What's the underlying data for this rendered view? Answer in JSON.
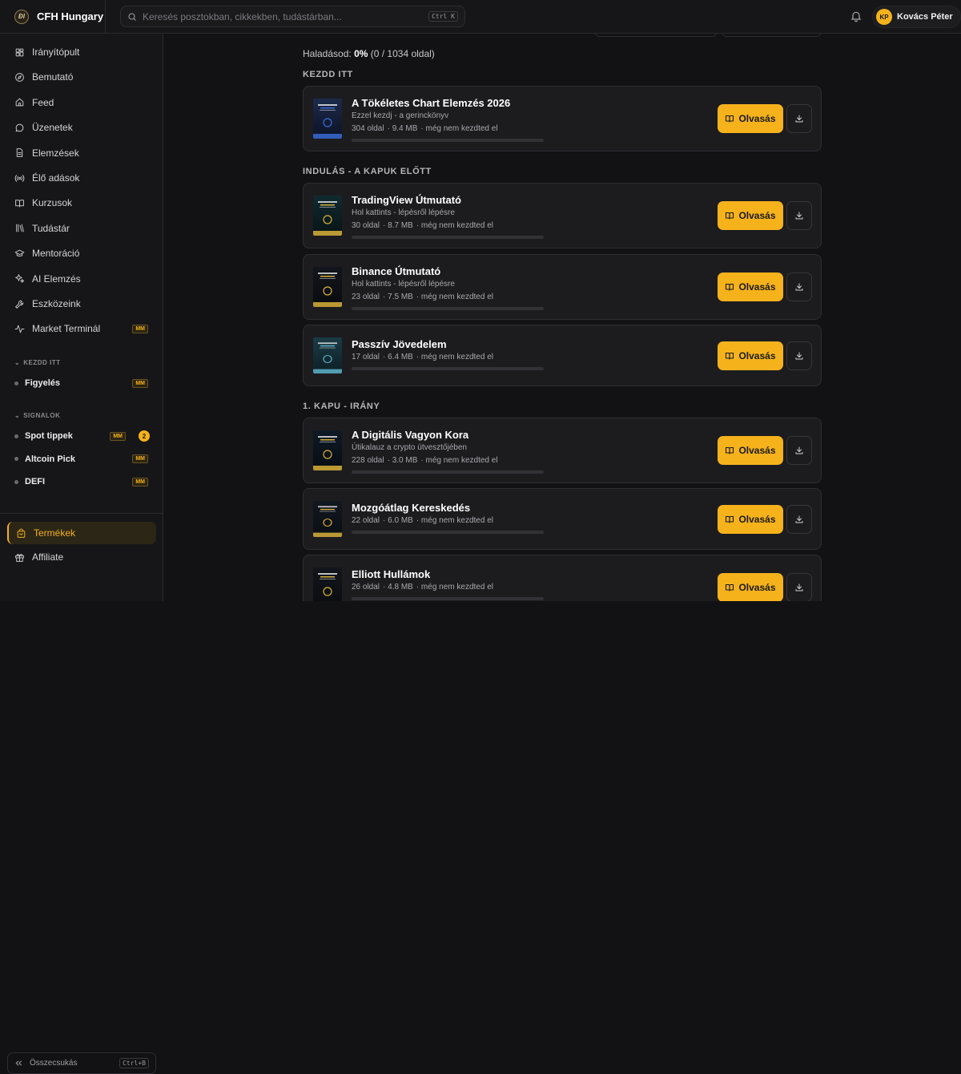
{
  "brand": {
    "logo_text": "ĐI",
    "name": "CFH Hungary"
  },
  "search": {
    "placeholder": "Keresés posztokban, cikkekben, tudástárban...",
    "shortcut": "Ctrl K"
  },
  "user": {
    "initials": "KP",
    "name": "Kovács Péter"
  },
  "sidebar": {
    "items": [
      {
        "label": "Irányítópult",
        "icon": "dashboard-icon"
      },
      {
        "label": "Bemutató",
        "icon": "compass-icon"
      },
      {
        "label": "Feed",
        "icon": "home-icon"
      },
      {
        "label": "Üzenetek",
        "icon": "message-icon"
      },
      {
        "label": "Elemzések",
        "icon": "document-icon"
      },
      {
        "label": "Élő adások",
        "icon": "broadcast-icon"
      },
      {
        "label": "Kurzusok",
        "icon": "book-icon"
      },
      {
        "label": "Tudástár",
        "icon": "library-icon"
      },
      {
        "label": "Mentoráció",
        "icon": "graduation-cap-icon"
      },
      {
        "label": "AI Elemzés",
        "icon": "sparkles-icon"
      },
      {
        "label": "Eszközeink",
        "icon": "wrench-icon"
      },
      {
        "label": "Market Terminál",
        "icon": "activity-icon",
        "badge": "MM"
      }
    ],
    "sections": [
      {
        "title": "KEZDD ITT",
        "items": [
          {
            "label": "Figyelés",
            "badge": "MM"
          }
        ]
      },
      {
        "title": "SIGNALOK",
        "items": [
          {
            "label": "Spot tippek",
            "badge": "MM",
            "count": "2"
          },
          {
            "label": "Altcoin Pick",
            "badge": "MM"
          },
          {
            "label": "DEFI",
            "badge": "MM"
          }
        ]
      }
    ],
    "bottom": [
      {
        "label": "Termékek",
        "icon": "bag-icon",
        "active": true
      },
      {
        "label": "Affiliate",
        "icon": "gift-icon"
      }
    ],
    "collapse": {
      "label": "Összecsukás",
      "shortcut": "Ctrl+B"
    }
  },
  "main": {
    "progress_label": "Haladásod:",
    "progress_percent": "0%",
    "progress_pages": "(0 / 1034 oldal)",
    "read_label": "Olvasás",
    "groups": [
      {
        "title": "KEZDD ITT",
        "books": [
          {
            "title": "A Tökéletes Chart Elemzés 2026",
            "subtitle": "Ezzel kezdj - a gerinckönyv",
            "pages": "304 oldal",
            "size": "· 9.4 MB",
            "status": "· még nem kezdted el",
            "progress": 0
          }
        ]
      },
      {
        "title": "INDULÁS - A KAPUK ELŐTT",
        "books": [
          {
            "title": "TradingView Útmutató",
            "subtitle": "Hol kattints - lépésről lépésre",
            "pages": "30 oldal",
            "size": "· 8.7 MB",
            "status": "· még nem kezdted el",
            "progress": 0
          },
          {
            "title": "Binance Útmutató",
            "subtitle": "Hol kattints - lépésről lépésre",
            "pages": "23 oldal",
            "size": "· 7.5 MB",
            "status": "· még nem kezdted el",
            "progress": 0
          },
          {
            "title": "Passzív Jövedelem",
            "subtitle": "",
            "pages": "17 oldal",
            "size": "· 6.4 MB",
            "status": "· még nem kezdted el",
            "progress": 0
          }
        ]
      },
      {
        "title": "1. KAPU - IRÁNY",
        "books": [
          {
            "title": "A Digitális Vagyon Kora",
            "subtitle": "Útikalauz a crypto útvesztőjében",
            "pages": "228 oldal",
            "size": "· 3.0 MB",
            "status": "· még nem kezdted el",
            "progress": 0
          },
          {
            "title": "Mozgóátlag Kereskedés",
            "subtitle": "",
            "pages": "22 oldal",
            "size": "· 6.0 MB",
            "status": "· még nem kezdted el",
            "progress": 0
          },
          {
            "title": "Elliott Hullámok",
            "subtitle": "",
            "pages": "26 oldal",
            "size": "· 4.8 MB",
            "status": "· még nem kezdted el",
            "progress": 0
          }
        ]
      }
    ]
  },
  "colors": {
    "accent": "#f5b21b",
    "background": "#121214",
    "card": "#1c1c1f"
  }
}
